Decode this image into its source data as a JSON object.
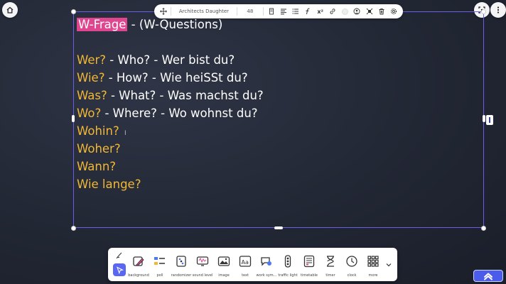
{
  "format_toolbar": {
    "font_name": "Architects Daughter",
    "font_size": "48",
    "icons": [
      "list-icon",
      "align-icon",
      "font-style-icon",
      "superscript-icon",
      "link-icon",
      "color-swatch-icon",
      "emoji-icon",
      "layer-icon",
      "delete-icon",
      "settings-icon"
    ],
    "superscript_label": "x²"
  },
  "content": {
    "title_highlight": "W-Frage",
    "title_rest": " - (W-Questions)",
    "lines": [
      {
        "word": "Wer?",
        "rest": " - Who? - Wer bist du?"
      },
      {
        "word": "Wie?",
        "rest": " - How? - Wie heiSSt du?"
      },
      {
        "word": "Was?",
        "rest": " - What? - Was machst du?"
      },
      {
        "word": "Wo?",
        "rest": " - Where? - Wo wohnst du?"
      },
      {
        "word": "Wohin?",
        "rest": ""
      },
      {
        "word": "Woher?",
        "rest": ""
      },
      {
        "word": "Wann?",
        "rest": ""
      },
      {
        "word": "Wie lange?",
        "rest": ""
      }
    ],
    "caret": "I"
  },
  "dock": {
    "tools": [
      {
        "label": "background",
        "icon": "background-icon"
      },
      {
        "label": "poll",
        "icon": "poll-icon"
      },
      {
        "label": "randomizer",
        "icon": "randomizer-icon"
      },
      {
        "label": "sound level",
        "icon": "sound-level-icon"
      },
      {
        "label": "image",
        "icon": "image-icon"
      },
      {
        "label": "text",
        "icon": "text-icon"
      },
      {
        "label": "work sym...",
        "icon": "work-symbols-icon"
      },
      {
        "label": "traffic light",
        "icon": "traffic-light-icon"
      },
      {
        "label": "timetable",
        "icon": "timetable-icon"
      },
      {
        "label": "timer",
        "icon": "timer-icon"
      },
      {
        "label": "clock",
        "icon": "clock-icon"
      },
      {
        "label": "more",
        "icon": "more-icon"
      }
    ]
  },
  "colors": {
    "accent": "#5a67f2",
    "highlight": "#e0468f",
    "keyword": "#f2b834",
    "selection": "#6a5ee8"
  }
}
